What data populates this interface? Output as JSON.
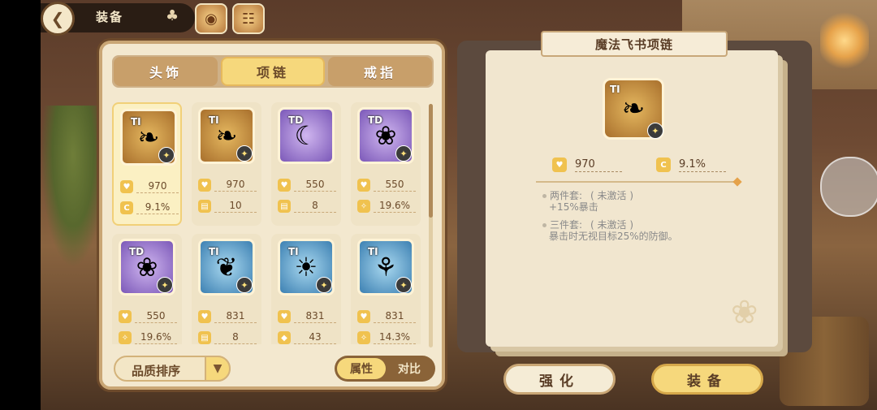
{
  "header": {
    "title": "装备",
    "top_icons": [
      "swirl-eye-icon",
      "spellbook-icon"
    ]
  },
  "tabs": [
    {
      "label": "头饰",
      "active": false
    },
    {
      "label": "项链",
      "active": true
    },
    {
      "label": "戒指",
      "active": false
    }
  ],
  "items": [
    {
      "tier": "TI",
      "frame": "gold",
      "icon": "green-dragonfly-necklace-icon",
      "stats": [
        {
          "icon": "heart",
          "value": "970"
        },
        {
          "icon": "crit",
          "value": "9.1%"
        }
      ],
      "selected": true
    },
    {
      "tier": "TI",
      "frame": "gold",
      "icon": "green-dragonfly-necklace-icon",
      "stats": [
        {
          "icon": "heart",
          "value": "970"
        },
        {
          "icon": "folder",
          "value": "10"
        }
      ],
      "selected": false
    },
    {
      "tier": "TD",
      "frame": "purple",
      "icon": "moon-pendant-icon",
      "stats": [
        {
          "icon": "heart",
          "value": "550"
        },
        {
          "icon": "folder",
          "value": "8"
        }
      ],
      "selected": false
    },
    {
      "tier": "TD",
      "frame": "purple",
      "icon": "red-bow-necklace-icon",
      "stats": [
        {
          "icon": "heart",
          "value": "550"
        },
        {
          "icon": "sparkle",
          "value": "19.6%"
        }
      ],
      "selected": false
    },
    {
      "tier": "TD",
      "frame": "purple",
      "icon": "red-bow-necklace-icon",
      "stats": [
        {
          "icon": "heart",
          "value": "550"
        },
        {
          "icon": "sparkle",
          "value": "19.6%"
        }
      ],
      "selected": false
    },
    {
      "tier": "TI",
      "frame": "blue",
      "icon": "red-ribbon-choker-icon",
      "stats": [
        {
          "icon": "heart",
          "value": "831"
        },
        {
          "icon": "folder",
          "value": "8"
        }
      ],
      "selected": false
    },
    {
      "tier": "TI",
      "frame": "blue",
      "icon": "sun-collar-icon",
      "stats": [
        {
          "icon": "heart",
          "value": "831"
        },
        {
          "icon": "shield",
          "value": "43"
        }
      ],
      "selected": false
    },
    {
      "tier": "TI",
      "frame": "blue",
      "icon": "wing-pendant-icon",
      "stats": [
        {
          "icon": "heart",
          "value": "831"
        },
        {
          "icon": "sparkle",
          "value": "14.3%"
        }
      ],
      "selected": false
    }
  ],
  "controls": {
    "sort_label": "品质排序",
    "toggle_on": "属性",
    "toggle_off": "对比"
  },
  "detail": {
    "title": "魔法飞书项链",
    "tier": "TI",
    "stats": [
      {
        "icon": "heart",
        "value": "970"
      },
      {
        "icon": "crit",
        "value": "9.1%"
      }
    ],
    "set2_head": "两件套:",
    "set2_state": "( 未激活 )",
    "set2_desc": "+15%暴击",
    "set3_head": "三件套:",
    "set3_state": "( 未激活 )",
    "set3_desc": "暴击时无视目标25%的防御。"
  },
  "actions": {
    "strengthen": "强化",
    "equip": "装备"
  }
}
